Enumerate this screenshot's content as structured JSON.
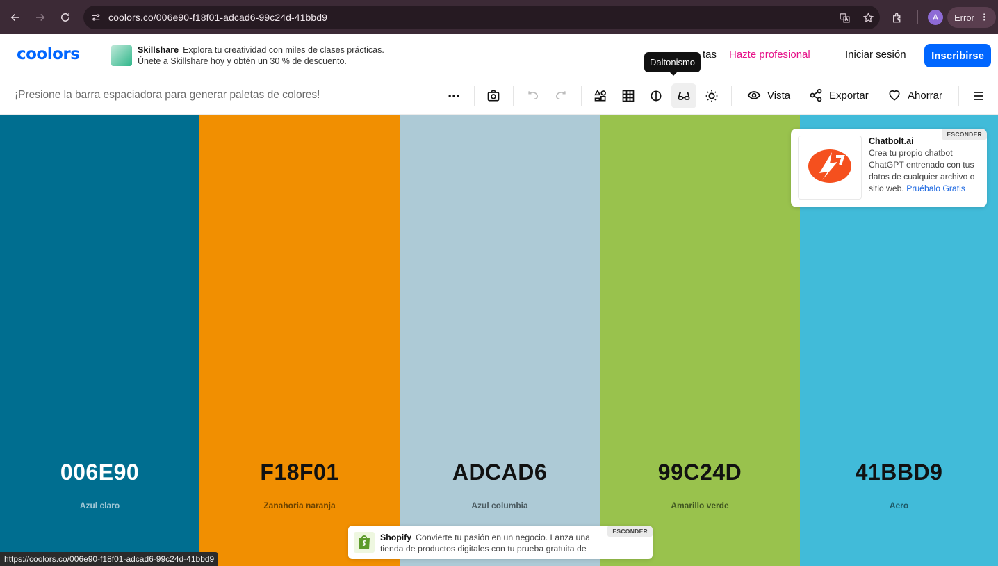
{
  "browser": {
    "url": "coolors.co/006e90-f18f01-adcad6-99c24d-41bbd9",
    "avatar_letter": "A",
    "error_label": "Error"
  },
  "header": {
    "logo": "coolors",
    "ad": {
      "brand": "Skillshare",
      "line1": "Explora tu creatividad con miles de clases prácticas.",
      "line2": "Únete a Skillshare hoy y obtén un 30 % de descuento."
    },
    "nav_partial": "tas",
    "pro_label": "Hazte profesional",
    "login_label": "Iniciar sesión",
    "signup_label": "Inscribirse",
    "tooltip": "Daltonismo"
  },
  "toolbar": {
    "hint": "¡Presione la barra espaciadora para generar paletas de colores!",
    "view_label": "Vista",
    "export_label": "Exportar",
    "save_label": "Ahorrar"
  },
  "palette": [
    {
      "hex": "006E90",
      "name": "Azul claro",
      "color": "#006E90",
      "text_color": "#ffffff",
      "name_color": "#9fc6d4"
    },
    {
      "hex": "F18F01",
      "name": "Zanahoria naranja",
      "color": "#F18F01",
      "text_color": "#111111",
      "name_color": "#6b4200"
    },
    {
      "hex": "ADCAD6",
      "name": "Azul columbia",
      "color": "#ADCAD6",
      "text_color": "#111111",
      "name_color": "#4a5a60"
    },
    {
      "hex": "99C24D",
      "name": "Amarillo verde",
      "color": "#99C24D",
      "text_color": "#111111",
      "name_color": "#3f5520"
    },
    {
      "hex": "41BBD9",
      "name": "Aero",
      "color": "#41BBD9",
      "text_color": "#111111",
      "name_color": "#1d5866"
    }
  ],
  "chatbolt_ad": {
    "hide_label": "ESCONDER",
    "title": "Chatbolt.ai",
    "body": "Crea tu propio chatbot ChatGPT entrenado con tus datos de cualquier archivo o sitio web.",
    "cta": "Pruébalo Gratis"
  },
  "shopify_ad": {
    "hide_label": "ESCONDER",
    "brand": "Shopify",
    "text": "Convierte tu pasión en un negocio. Lanza una tienda de productos digitales con tu prueba gratuita de"
  },
  "status_url": "https://coolors.co/006e90-f18f01-adcad6-99c24d-41bbd9"
}
